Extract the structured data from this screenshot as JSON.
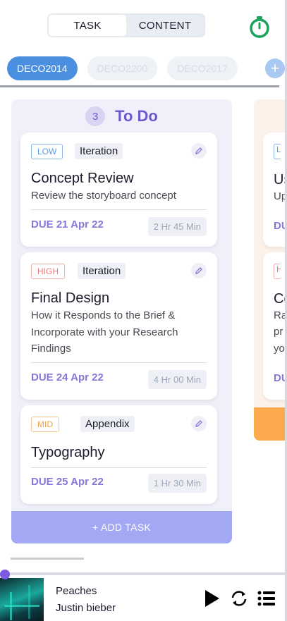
{
  "toggle": {
    "task_label": "TASK",
    "content_label": "CONTENT",
    "active": "CONTENT"
  },
  "courses": {
    "items": [
      "DECO2014",
      "DECO2200",
      "DECO2017"
    ],
    "active": "DECO2014",
    "add_label": "+"
  },
  "column": {
    "count": "3",
    "title": "To Do",
    "add_task_label": "+ ADD TASK",
    "cards": [
      {
        "priority": "LOW",
        "tag": "Iteration",
        "title": "Concept Review",
        "description": "Review the storyboard concept",
        "due": "DUE 21 Apr 22",
        "duration": "2 Hr 45 Min"
      },
      {
        "priority": "HIGH",
        "tag": "Iteration",
        "title": "Final Design",
        "description": "How it Responds to the Brief & Incorporate with your Research Findings",
        "due": "DUE 24 Apr 22",
        "duration": "4 Hr 00 Min"
      },
      {
        "priority": "MID",
        "tag": "Appendix",
        "title": "Typography",
        "description": "",
        "due": "DUE 25 Apr 22",
        "duration": "1 Hr 30 Min"
      }
    ]
  },
  "next_column_peek": {
    "cards": [
      {
        "priority": "L",
        "title": "Us",
        "desc": [
          "Up"
        ],
        "due": "DU"
      },
      {
        "priority": "H",
        "title": "Co",
        "desc": [
          "Ra",
          "pr",
          "yo"
        ],
        "due": "DU"
      }
    ]
  },
  "player": {
    "song": "Peaches",
    "artist": "Justin bieber"
  },
  "colors": {
    "accent": "#6a5acd",
    "chip_active": "#4a8fe0",
    "add_task": "#a2a8f4",
    "timer": "#1aa35c"
  }
}
